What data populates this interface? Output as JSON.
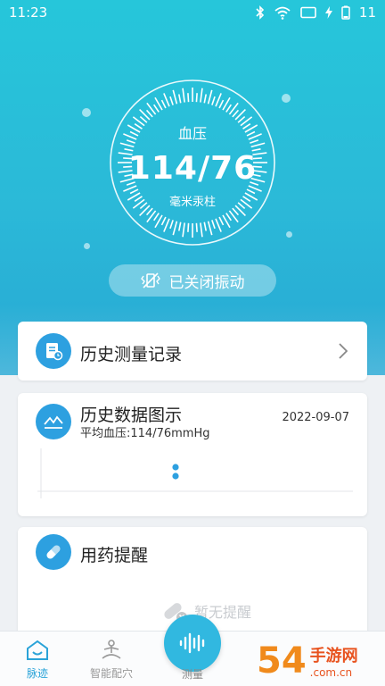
{
  "status": {
    "time": "11:23",
    "battery": "11"
  },
  "gauge": {
    "label": "血压",
    "value": "114/76",
    "unit": "毫米汞柱"
  },
  "vibration": {
    "label": "已关闭振动",
    "icon": "vibration-off-icon"
  },
  "history_records": {
    "title": "历史测量记录",
    "icon": "record-icon"
  },
  "history_chart": {
    "title": "历史数据图示",
    "date": "2022-09-07",
    "subtitle": "平均血压:114/76mmHg",
    "icon": "chart-icon"
  },
  "medication": {
    "title": "用药提醒",
    "empty_text": "暂无提醒",
    "icon": "pill-icon"
  },
  "nav": {
    "pulse": "脉迹",
    "acupoint": "智能配穴",
    "measure": "测量"
  },
  "colors": {
    "accent": "#2da0e0",
    "hero_top": "#26c6da",
    "active_nav": "#2aa3d8"
  },
  "watermark": {
    "number": "54",
    "text": "手游网",
    "domain": ".com.cn"
  }
}
